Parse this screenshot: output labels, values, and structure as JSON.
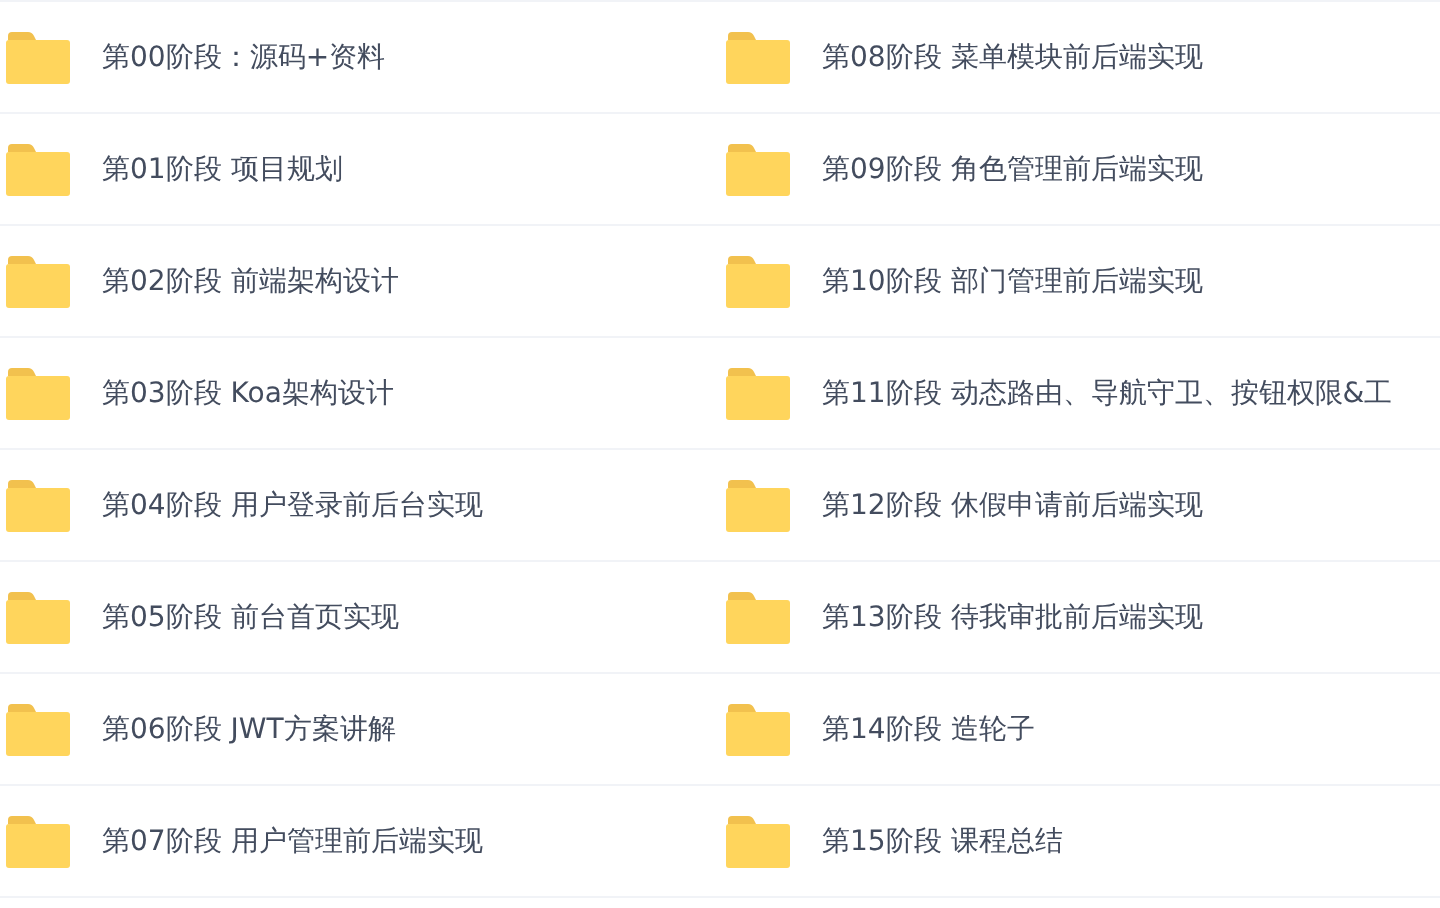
{
  "columns": [
    {
      "folders": [
        {
          "name": "第00阶段：源码+资料"
        },
        {
          "name": "第01阶段 项目规划"
        },
        {
          "name": "第02阶段 前端架构设计"
        },
        {
          "name": "第03阶段 Koa架构设计"
        },
        {
          "name": "第04阶段 用户登录前后台实现"
        },
        {
          "name": "第05阶段 前台首页实现"
        },
        {
          "name": "第06阶段 JWT方案讲解"
        },
        {
          "name": "第07阶段 用户管理前后端实现"
        }
      ]
    },
    {
      "folders": [
        {
          "name": "第08阶段 菜单模块前后端实现"
        },
        {
          "name": "第09阶段 角色管理前后端实现"
        },
        {
          "name": "第10阶段 部门管理前后端实现"
        },
        {
          "name": "第11阶段 动态路由、导航守卫、按钮权限&工"
        },
        {
          "name": "第12阶段 休假申请前后端实现"
        },
        {
          "name": "第13阶段 待我审批前后端实现"
        },
        {
          "name": "第14阶段 造轮子"
        },
        {
          "name": "第15阶段 课程总结"
        }
      ]
    }
  ]
}
